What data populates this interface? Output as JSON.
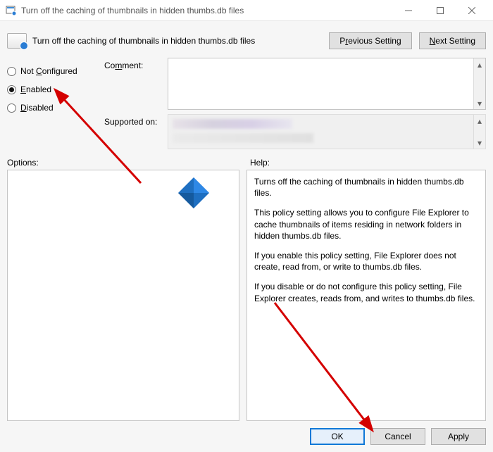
{
  "window": {
    "title": "Turn off the caching of thumbnails in hidden thumbs.db files"
  },
  "header": {
    "policy_title": "Turn off the caching of thumbnails in hidden thumbs.db files",
    "prev_label_pre": "P",
    "prev_label_u": "r",
    "prev_label_post": "evious Setting",
    "next_label_u": "N",
    "next_label_post": "ext Setting"
  },
  "state": {
    "not_configured_pre": "Not ",
    "not_configured_u": "C",
    "not_configured_post": "onfigured",
    "enabled_u": "E",
    "enabled_post": "nabled",
    "disabled_u": "D",
    "disabled_post": "isabled",
    "selected": "enabled"
  },
  "fields": {
    "comment_label_pre": "Co",
    "comment_label_u": "m",
    "comment_label_post": "ment:",
    "comment_value": "",
    "supported_label": "Supported on:"
  },
  "sections": {
    "options_label": "Options:",
    "help_label": "Help:"
  },
  "help": {
    "p1": "Turns off the caching of thumbnails in hidden thumbs.db files.",
    "p2": "This policy setting allows you to configure File Explorer to cache thumbnails of items residing in network folders in hidden thumbs.db files.",
    "p3": "If you enable this policy setting, File Explorer does not create, read from, or write to thumbs.db files.",
    "p4": "If you disable or do not configure this policy setting, File Explorer creates, reads from, and writes to thumbs.db files."
  },
  "footer": {
    "ok": "OK",
    "cancel": "Cancel",
    "apply": "Apply"
  }
}
